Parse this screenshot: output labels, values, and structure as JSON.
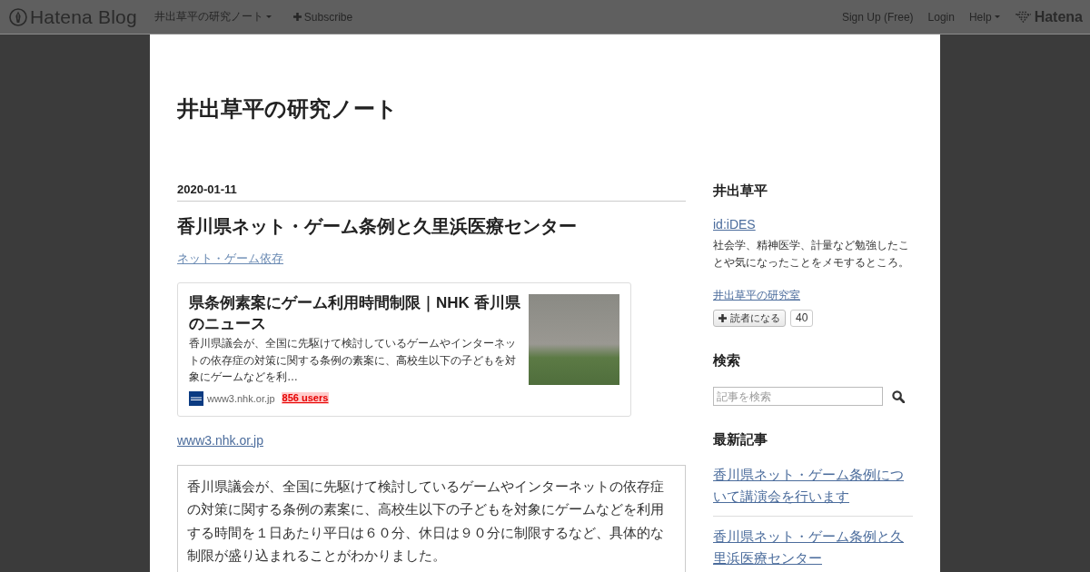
{
  "top_bar": {
    "logo": "Hatena Blog",
    "nav": [
      {
        "label": "井出草平の研究ノート",
        "kind": "menu"
      },
      {
        "label": "Subscribe",
        "kind": "add"
      }
    ],
    "account": [
      {
        "label": "Sign Up (Free)",
        "kind": "link"
      },
      {
        "label": "Login",
        "kind": "link"
      },
      {
        "label": "Help",
        "kind": "menu"
      }
    ],
    "brand": "Hatena"
  },
  "blog": {
    "title": "井出草平の研究ノート"
  },
  "entry": {
    "date": "2020-01-11",
    "title": "香川県ネット・ゲーム条例と久里浜医療センター",
    "categories": [
      "ネット・ゲーム依存"
    ],
    "embed_card": {
      "title": "県条例素案にゲーム利用時間制限｜NHK 香川県のニュース",
      "description": "香川県議会が、全国に先駆けて検討しているゲームやインターネットの依存症の対策に関する条例の素案に、高校生以下の子どもを対象にゲームなどを利…",
      "domain": "www3.nhk.or.jp",
      "bookmarks": "856 users"
    },
    "source_link": "www3.nhk.or.jp",
    "quote": "香川県議会が、全国に先駆けて検討しているゲームやインターネットの依存症の対策に関する条例の素案に、高校生以下の子どもを対象にゲームなどを利用する時間を１日あたり平日は６０分、休日は９０分に制限するなど、具体的な制限が盛り込まれることがわかりました。"
  },
  "sidebar": {
    "profile": {
      "heading": "井出草平",
      "id_link": "id:iDES",
      "about": "社会学、精神医学、計量など勉強したことや気になったことをメモするところ。",
      "site_link": "井出草平の研究室",
      "subscribe_button": "読者になる",
      "subscriber_count": "40"
    },
    "search": {
      "heading": "検索",
      "placeholder": "記事を検索"
    },
    "recent": {
      "heading": "最新記事",
      "items": [
        "香川県ネット・ゲーム条例について講演会を行います",
        "香川県ネット・ゲーム条例と久里浜医療センター"
      ]
    }
  }
}
